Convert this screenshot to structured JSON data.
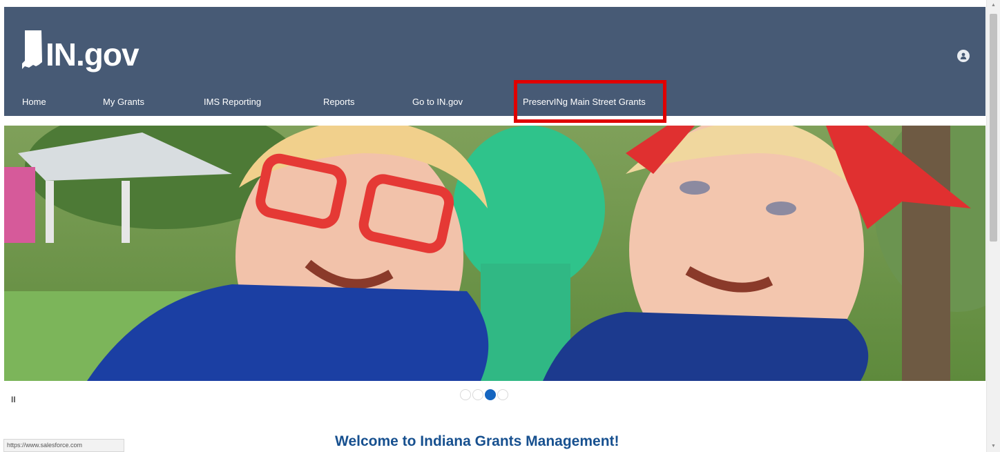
{
  "header": {
    "logo_text": "IN.gov",
    "user_icon": "user-avatar-icon",
    "background_color": "#475a75"
  },
  "nav": {
    "items": [
      {
        "label": "Home"
      },
      {
        "label": "My Grants"
      },
      {
        "label": "IMS Reporting"
      },
      {
        "label": "Reports"
      },
      {
        "label": "Go to IN.gov"
      },
      {
        "label": "PreservINg Main Street Grants"
      }
    ],
    "highlight_color": "#e00000"
  },
  "hero": {
    "image_description_icon": "hero-carousel-image",
    "pause_label": "II",
    "slide_count": 4,
    "active_slide": 3
  },
  "main": {
    "welcome_title": "Welcome to Indiana Grants Management!",
    "title_color": "#17508f"
  },
  "statusbar": {
    "url": "https://www.salesforce.com"
  }
}
